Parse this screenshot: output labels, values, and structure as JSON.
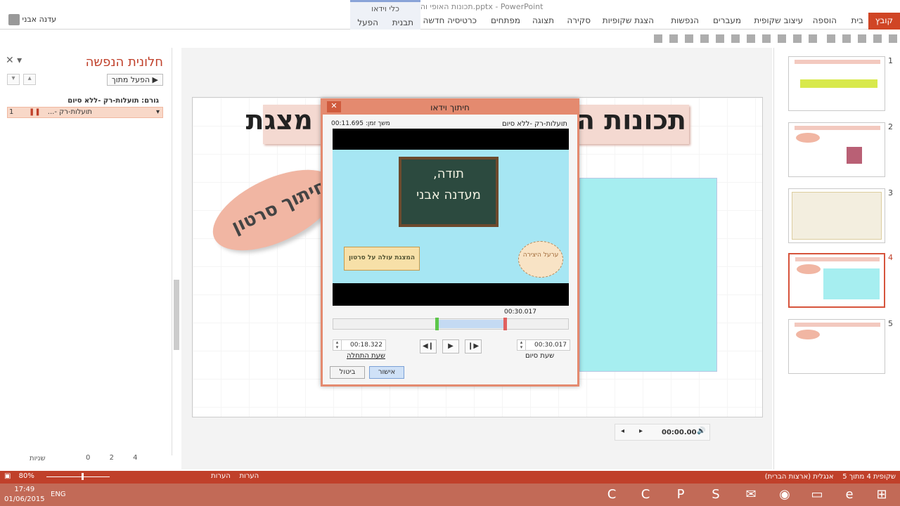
{
  "window": {
    "title": "תכונות האופי והיופי שבעריכת מצגת.pptx - PowerPoint"
  },
  "user": {
    "name": "עדנה אבני"
  },
  "ribbon": {
    "file_tab": "קובץ",
    "tabs": [
      "בית",
      "הוספה",
      "עיצוב שקופית",
      "מעברים",
      "הנפשות",
      "הצגת שקופיות",
      "סקירה",
      "תצוגה",
      "מפתחים",
      "כרטיסיה חדשה"
    ],
    "video_tools_label": "כלי וידאו",
    "video_tabs": [
      "תבנית",
      "הפעל"
    ]
  },
  "animation_pane": {
    "title": "חלונית הנפשה",
    "play_from_label": "הפעל מתוך",
    "trigger_label": "גורם: תועלות-רק -ללא סיום",
    "item": {
      "number": "1",
      "label": "תועלות-רק -..."
    },
    "seconds_label": "שניות",
    "scale": [
      "0",
      "2",
      "4"
    ]
  },
  "slide": {
    "title_text": "תכונות האופי והיופי שבעריכת מצגת",
    "ellipse_text": "חיתוך סרטון",
    "video_time": "00:00.00"
  },
  "thumbnails": {
    "numbers": [
      "1",
      "2",
      "3",
      "4",
      "5"
    ],
    "selected_index": 3
  },
  "trim_dialog": {
    "title": "חיתוך וידאו",
    "video_name": "תועלות-רק -ללא סיום",
    "duration": "משך זמן: 00:11.695",
    "end_marker_time": "00:30.017",
    "start_time": "00:18.322",
    "end_time": "00:30.017",
    "start_label": "שעת התחלה",
    "end_label": "שעת סיום",
    "ok_label": "אישור",
    "cancel_label": "ביטול",
    "frame": {
      "chalkboard_line1": "תודה,",
      "chalkboard_line2": "מעדנה אבני",
      "banner_text": "המצגת עולה על סרטון",
      "logo_text": "ערעל היצירה"
    },
    "trim_start_fraction": 0.44,
    "trim_end_fraction": 0.73
  },
  "status_bar": {
    "slide_info": "שקופית 4 מתוך 5",
    "language": "אנגלית (ארצות הברית)",
    "notes_label": "הערות",
    "comments_label": "הערות",
    "zoom": "80%"
  },
  "taskbar": {
    "time": "17:49",
    "date": "01/06/2015",
    "lang": "ENG"
  },
  "colors": {
    "accent": "#c0402a",
    "file_tab": "#d04525",
    "dialog_border": "#e48a6f",
    "video_fill": "#a6eef0",
    "taskbar": "#c26a57"
  }
}
